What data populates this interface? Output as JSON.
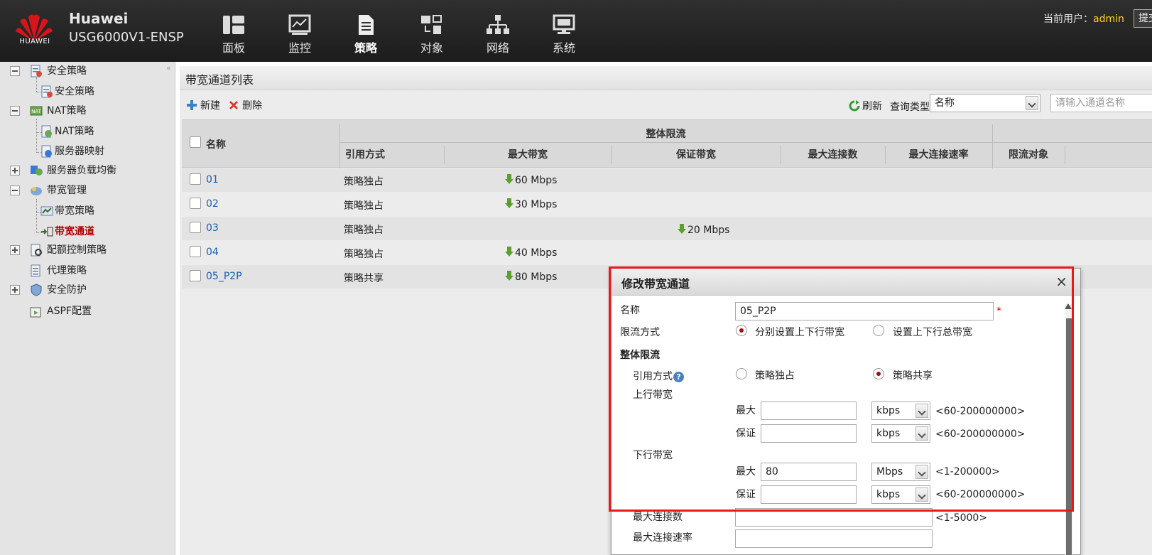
{
  "header": {
    "brand_logo_text": "HUAWEI",
    "brand_name": "Huawei",
    "brand_model": "USG6000V1-ENSP",
    "nav": [
      {
        "label": "面板",
        "icon": "dashboard-icon"
      },
      {
        "label": "监控",
        "icon": "monitor-icon"
      },
      {
        "label": "策略",
        "icon": "policy-document-icon"
      },
      {
        "label": "对象",
        "icon": "object-icon"
      },
      {
        "label": "网络",
        "icon": "network-icon"
      },
      {
        "label": "系统",
        "icon": "system-icon"
      }
    ],
    "active_nav": "策略",
    "user_prefix": "当前用户：",
    "user_name": "admin",
    "submit_label": "提交"
  },
  "sidebar": {
    "items": [
      {
        "label": "安全策略",
        "toggle": "minus",
        "icon": "security-policy-icon"
      },
      {
        "label": "安全策略",
        "icon": "security-policy-icon"
      },
      {
        "label": "NAT策略",
        "toggle": "minus",
        "icon": "nat-icon"
      },
      {
        "label": "NAT策略",
        "icon": "nat-icon"
      },
      {
        "label": "服务器映射",
        "icon": "server-mapping-icon"
      },
      {
        "label": "服务器负载均衡",
        "toggle": "plus",
        "icon": "load-balance-icon"
      },
      {
        "label": "带宽管理",
        "toggle": "minus",
        "icon": "bandwidth-icon"
      },
      {
        "label": "带宽策略",
        "icon": "bandwidth-policy-icon"
      },
      {
        "label": "带宽通道",
        "icon": "bandwidth-channel-icon",
        "selected": true
      },
      {
        "label": "配额控制策略",
        "toggle": "plus",
        "icon": "quota-icon"
      },
      {
        "label": "代理策略",
        "icon": "proxy-icon"
      },
      {
        "label": "安全防护",
        "toggle": "plus",
        "icon": "shield-icon"
      },
      {
        "label": "ASPF配置",
        "icon": "aspf-icon"
      }
    ]
  },
  "main": {
    "title": "带宽通道列表",
    "toolbar": {
      "new_label": "新建",
      "delete_label": "删除",
      "refresh_label": "刷新",
      "query_type_label": "查询类型",
      "query_type_value": "名称",
      "search_placeholder": "请输入通道名称"
    },
    "table": {
      "group_header": "整体限流",
      "columns": {
        "name": "名称",
        "ref_mode": "引用方式",
        "max_bw": "最大带宽",
        "guarantee_bw": "保证带宽",
        "max_conn": "最大连接数",
        "max_conn_rate": "最大连接速率",
        "limit_target": "限流对象"
      },
      "rows": [
        {
          "name": "01",
          "ref_mode": "策略独占",
          "max_bw": "60 Mbps",
          "guarantee_bw": ""
        },
        {
          "name": "02",
          "ref_mode": "策略独占",
          "max_bw": "30 Mbps",
          "guarantee_bw": ""
        },
        {
          "name": "03",
          "ref_mode": "策略独占",
          "max_bw": "",
          "guarantee_bw": "20 Mbps"
        },
        {
          "name": "04",
          "ref_mode": "策略独占",
          "max_bw": "40 Mbps",
          "guarantee_bw": ""
        },
        {
          "name": "05_P2P",
          "ref_mode": "策略共享",
          "max_bw": "80 Mbps",
          "guarantee_bw": ""
        }
      ]
    }
  },
  "dialog": {
    "title": "修改带宽通道",
    "close_symbol": "×",
    "name_label": "名称",
    "name_value": "05_P2P",
    "required_mark": "*",
    "limit_mode_label": "限流方式",
    "limit_mode_options": [
      "分别设置上下行带宽",
      "设置上下行总带宽"
    ],
    "limit_mode_selected": 0,
    "overall_section": "整体限流",
    "ref_mode_label": "引用方式",
    "help_symbol": "?",
    "ref_mode_options": [
      "策略独占",
      "策略共享"
    ],
    "ref_mode_selected": 1,
    "upstream_label": "上行带宽",
    "downstream_label": "下行带宽",
    "max_label": "最大",
    "guarantee_label": "保证",
    "up_max": {
      "value": "",
      "unit": "kbps",
      "range": "<60-200000000>"
    },
    "up_guarantee": {
      "value": "",
      "unit": "kbps",
      "range": "<60-200000000>"
    },
    "down_max": {
      "value": "80",
      "unit": "Mbps",
      "range": "<1-200000>"
    },
    "down_guarantee": {
      "value": "",
      "unit": "kbps",
      "range": "<60-200000000>"
    },
    "max_conn_label": "最大连接数",
    "max_conn_range": "<1-5000>",
    "max_conn_rate_label": "最大连接速率"
  },
  "colors": {
    "accent_red": "#e8191a",
    "link_blue": "#1a5fb4",
    "selected_red": "#b00000",
    "username_yellow": "#ffd320"
  }
}
